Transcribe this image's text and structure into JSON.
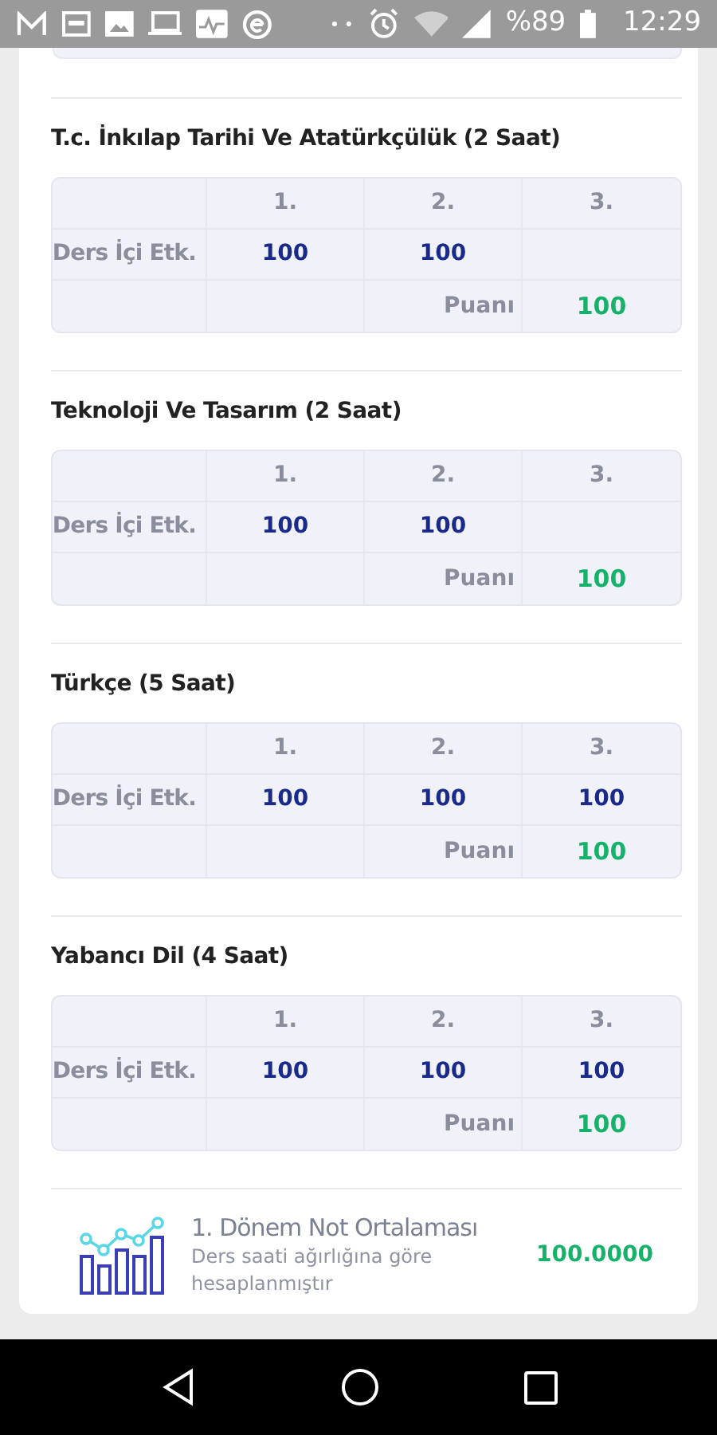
{
  "status_bar": {
    "battery": "%89",
    "time": "12:29"
  },
  "courses": [
    {
      "title": "T.c. İnkılap Tarihi Ve Atatürkçülük (2 Saat)",
      "row_label": "Ders İçi Etk.",
      "terms": [
        {
          "term": "1.",
          "score": "100"
        },
        {
          "term": "2.",
          "score": "100"
        },
        {
          "term": "3."
        }
      ],
      "score_label": "Puanı",
      "score": "100"
    },
    {
      "title": "Teknoloji Ve Tasarım (2 Saat)",
      "row_label": "Ders İçi Etk.",
      "terms": [
        {
          "term": "1.",
          "score": "100"
        },
        {
          "term": "2.",
          "score": "100"
        },
        {
          "term": "3."
        }
      ],
      "score_label": "Puanı",
      "score": "100"
    },
    {
      "title": "Türkçe (5 Saat)",
      "row_label": "Ders İçi Etk.",
      "terms": [
        {
          "term": "1.",
          "score": "100"
        },
        {
          "term": "2.",
          "score": "100"
        },
        {
          "term": "3.",
          "score": "100"
        }
      ],
      "score_label": "Puanı",
      "score": "100"
    },
    {
      "title": "Yabancı Dil (4 Saat)",
      "row_label": "Ders İçi Etk.",
      "terms": [
        {
          "term": "1.",
          "score": "100"
        },
        {
          "term": "2.",
          "score": "100"
        },
        {
          "term": "3.",
          "score": "100"
        }
      ],
      "score_label": "Puanı",
      "score": "100"
    }
  ],
  "summary": {
    "title": "1. Dönem Not Ortalaması",
    "subtitle": "Ders saati ağırlığına göre hesaplanmıştır",
    "value": "100.0000"
  }
}
